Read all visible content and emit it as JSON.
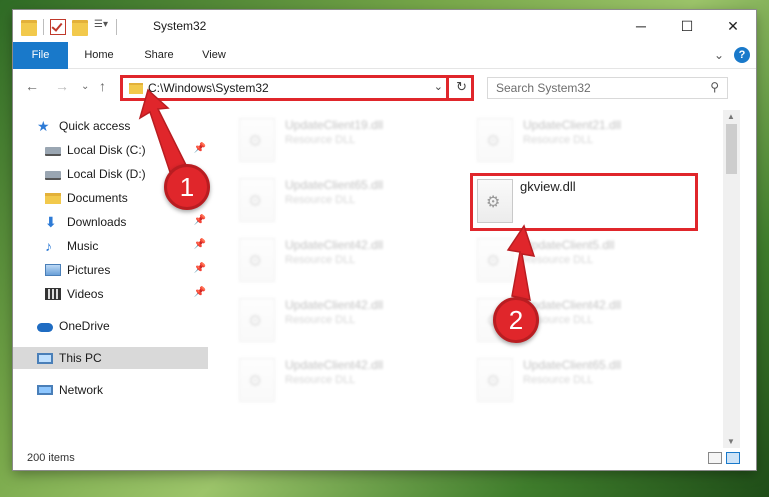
{
  "window": {
    "title": "System32",
    "controls": {
      "minimize": "─",
      "maximize": "☐",
      "close": "✕"
    }
  },
  "ribbon": {
    "tabs": [
      {
        "label": "File"
      },
      {
        "label": "Home"
      },
      {
        "label": "Share"
      },
      {
        "label": "View"
      }
    ],
    "expand_icon": "⌄",
    "help_label": "?"
  },
  "address_bar": {
    "path": "C:\\Windows\\System32",
    "dropdown": "⌄",
    "refresh": "↻"
  },
  "search": {
    "placeholder": "Search System32"
  },
  "nav_buttons": {
    "back": "←",
    "forward": "→",
    "recent": "⌄",
    "up": "↑"
  },
  "navigation_pane": {
    "items": [
      {
        "label": "Quick access",
        "icon": "star-icon"
      },
      {
        "label": "Local Disk (C:)",
        "icon": "disk-icon"
      },
      {
        "label": "Local Disk (D:)",
        "icon": "disk-icon"
      },
      {
        "label": "Documents",
        "icon": "documents-icon"
      },
      {
        "label": "Downloads",
        "icon": "download-icon"
      },
      {
        "label": "Music",
        "icon": "music-icon"
      },
      {
        "label": "Pictures",
        "icon": "pictures-icon"
      },
      {
        "label": "Videos",
        "icon": "videos-icon"
      },
      {
        "label": "OneDrive",
        "icon": "cloud-icon"
      },
      {
        "label": "This PC",
        "icon": "computer-icon",
        "selected": true
      },
      {
        "label": "Network",
        "icon": "network-icon"
      }
    ]
  },
  "files": [
    {
      "name": "UpdateClient19.dll",
      "type": "Resource DLL"
    },
    {
      "name": "UpdateClient21.dll",
      "type": "Resource DLL"
    },
    {
      "name": "UpdateClient65.dll",
      "type": "Resource DLL"
    },
    {
      "name": "gkview.dll",
      "type": "",
      "highlighted": true
    },
    {
      "name": "UpdateClient42.dll",
      "type": "Resource DLL"
    },
    {
      "name": "UpdateClient5.dll",
      "type": "Resource DLL"
    },
    {
      "name": "UpdateClient42.dll",
      "type": "Resource DLL"
    },
    {
      "name": "UpdateClient42.dll",
      "type": "Resource DLL"
    },
    {
      "name": "UpdateClient42.dll",
      "type": "Resource DLL"
    },
    {
      "name": "UpdateClient65.dll",
      "type": "Resource DLL"
    }
  ],
  "status_bar": {
    "item_count": "200 items"
  },
  "annotations": {
    "step1": "1",
    "step2": "2",
    "color": "#e0262b"
  }
}
